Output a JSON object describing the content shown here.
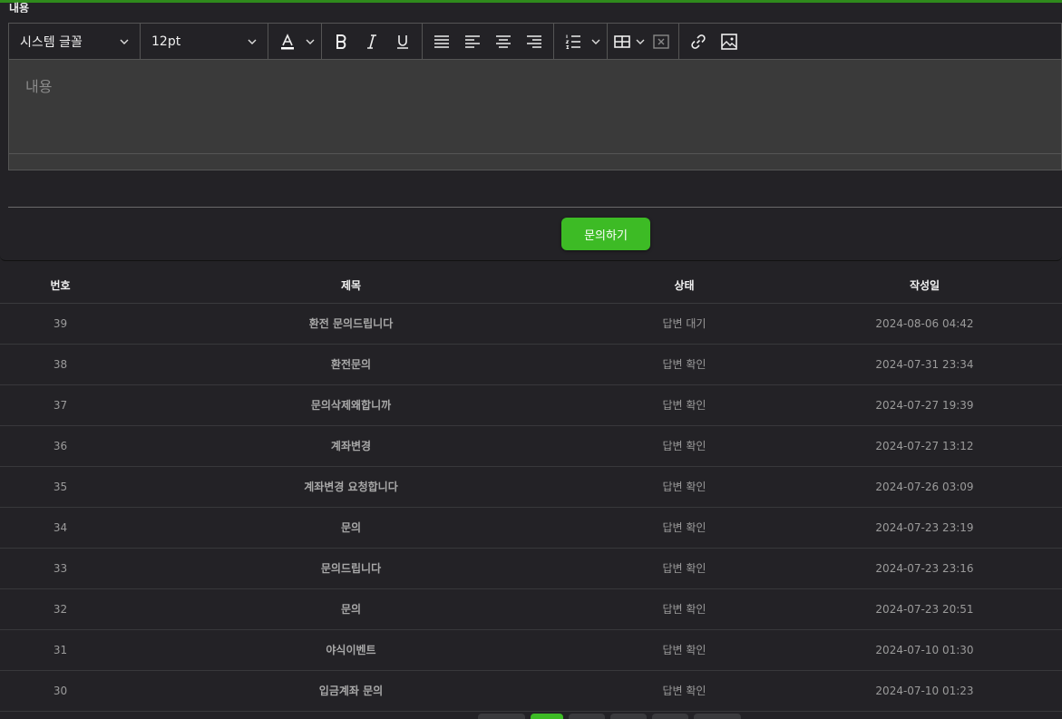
{
  "form": {
    "content_label": "내용",
    "toolbar": {
      "font_family": "시스템 글꼴",
      "font_size": "12pt"
    },
    "editor_placeholder": "내용",
    "submit_label": "문의하기",
    "accent_color": "#3dbb25"
  },
  "table": {
    "headers": {
      "no": "번호",
      "title": "제목",
      "status": "상태",
      "date": "작성일"
    },
    "rows": [
      {
        "no": "39",
        "title": "환전 문의드립니다",
        "status": "답변 대기",
        "date": "2024-08-06 04:42"
      },
      {
        "no": "38",
        "title": "환전문의",
        "status": "답변 확인",
        "date": "2024-07-31 23:34"
      },
      {
        "no": "37",
        "title": "문의삭제왜합니까",
        "status": "답변 확인",
        "date": "2024-07-27 19:39"
      },
      {
        "no": "36",
        "title": "계좌변경",
        "status": "답변 확인",
        "date": "2024-07-27 13:12"
      },
      {
        "no": "35",
        "title": "계좌변경 요청합니다",
        "status": "답변 확인",
        "date": "2024-07-26 03:09"
      },
      {
        "no": "34",
        "title": "문의",
        "status": "답변 확인",
        "date": "2024-07-23 23:19"
      },
      {
        "no": "33",
        "title": "문의드립니다",
        "status": "답변 확인",
        "date": "2024-07-23 23:16"
      },
      {
        "no": "32",
        "title": "문의",
        "status": "답변 확인",
        "date": "2024-07-23 20:51"
      },
      {
        "no": "31",
        "title": "야식이벤트",
        "status": "답변 확인",
        "date": "2024-07-10 01:30"
      },
      {
        "no": "30",
        "title": "입금계좌 문의",
        "status": "답변 확인",
        "date": "2024-07-10 01:23"
      }
    ]
  }
}
